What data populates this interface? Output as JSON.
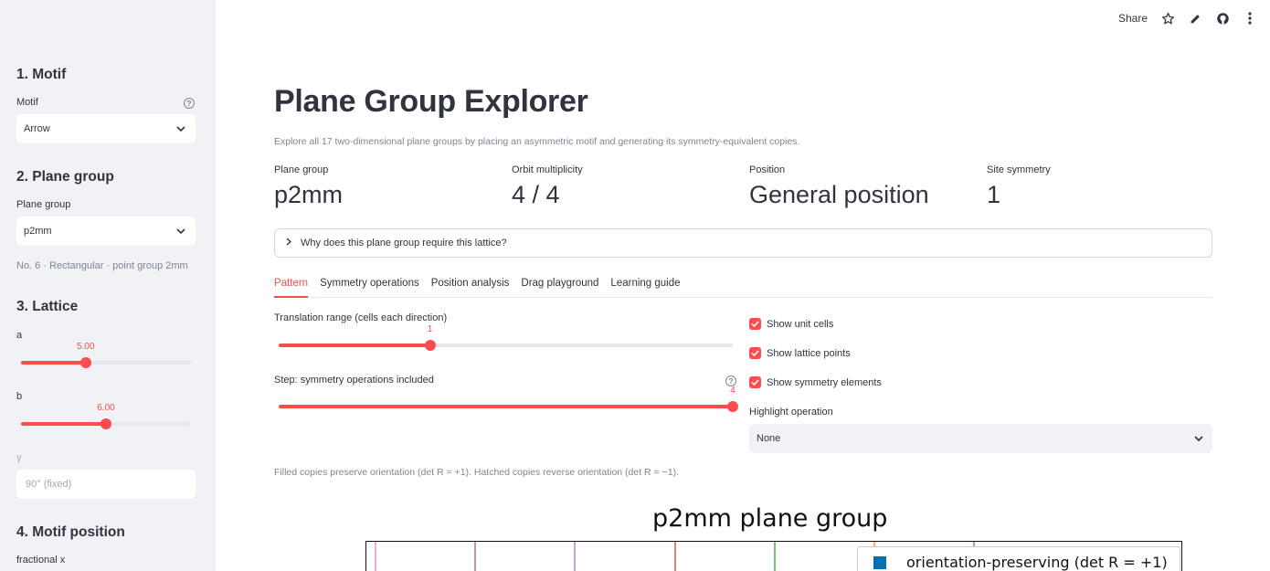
{
  "toolbar": {
    "share_label": "Share"
  },
  "sidebar": {
    "motif_heading": "1. Motif",
    "motif_label": "Motif",
    "motif_value": "Arrow",
    "plane_group_heading": "2. Plane group",
    "plane_group_label": "Plane group",
    "plane_group_value": "p2mm",
    "plane_group_caption": "No. 6 · Rectangular · point group 2mm",
    "lattice_heading": "3. Lattice",
    "a_label": "a",
    "a_value": "5.00",
    "a_fraction": 0.38,
    "b_label": "b",
    "b_value": "6.00",
    "b_fraction": 0.5,
    "gamma_label": "γ",
    "gamma_placeholder": "90° (fixed)",
    "motif_position_heading": "4. Motif position",
    "fractional_x_label": "fractional x"
  },
  "main": {
    "title": "Plane Group Explorer",
    "subtitle": "Explore all 17 two-dimensional plane groups by placing an asymmetric motif and generating its symmetry-equivalent copies.",
    "metrics": [
      {
        "label": "Plane group",
        "value": "p2mm"
      },
      {
        "label": "Orbit multiplicity",
        "value": "4 / 4"
      },
      {
        "label": "Position",
        "value": "General position"
      },
      {
        "label": "Site symmetry",
        "value": "1"
      }
    ],
    "expander_label": "Why does this plane group require this lattice?",
    "tabs": [
      "Pattern",
      "Symmetry operations",
      "Position analysis",
      "Drag playground",
      "Learning guide"
    ],
    "translation_label": "Translation range (cells each direction)",
    "translation_value": "1",
    "translation_fraction": 0.333,
    "step_label": "Step: symmetry operations included",
    "step_value": "4",
    "step_fraction": 1.0,
    "checkboxes": [
      "Show unit cells",
      "Show lattice points",
      "Show symmetry elements"
    ],
    "highlight_label": "Highlight operation",
    "highlight_value": "None",
    "caption": "Filled copies preserve orientation (det R = +1). Hatched copies reverse orientation (det R = −1).",
    "chart_title": "p2mm plane group",
    "legend_label": "orientation-preserving (det R = +1)"
  },
  "colors": {
    "accent": "#ff4b4b",
    "legend_swatch": "#0072b2"
  }
}
